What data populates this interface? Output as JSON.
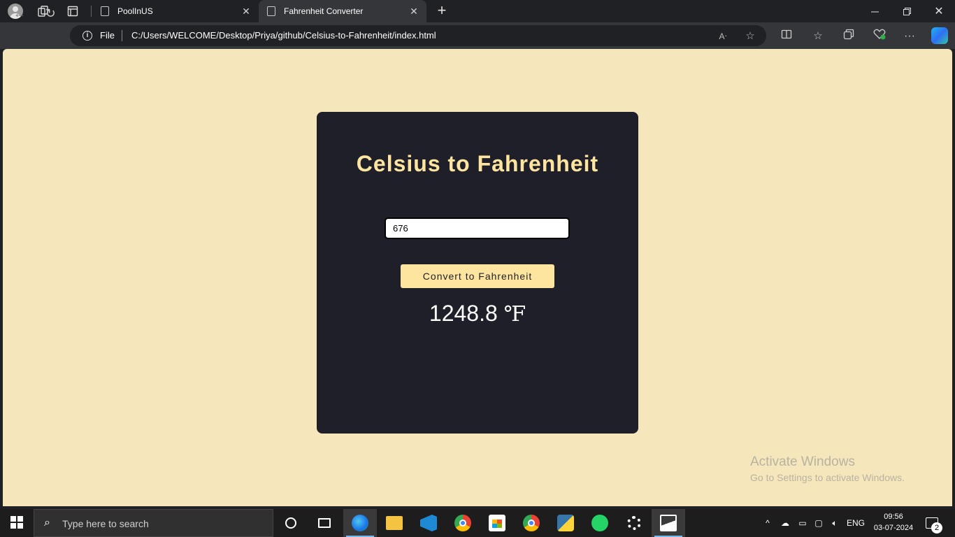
{
  "browser": {
    "tabs": [
      {
        "title": "PoolInUS"
      },
      {
        "title": "Fahrenheit Converter",
        "active": true
      }
    ],
    "address": {
      "scheme_label": "File",
      "url": "C:/Users/WELCOME/Desktop/Priya/github/Celsius-to-Fahrenheit/index.html"
    }
  },
  "page": {
    "title": "Celsius to Fahrenheit",
    "input_value": "676",
    "button_label": "Convert to Fahrenheit",
    "result_value": "1248.8",
    "result_unit": "℉",
    "colors": {
      "background": "#f5e6bc",
      "card": "#1f1f2a",
      "accent": "#fde59f"
    }
  },
  "watermark": {
    "line1": "Activate Windows",
    "line2": "Go to Settings to activate Windows."
  },
  "taskbar": {
    "search_placeholder": "Type here to search",
    "language": "ENG",
    "time": "09:56",
    "date": "03-07-2024",
    "notification_count": "2",
    "apps": [
      "cortana-icon",
      "task-view-icon",
      "edge-icon",
      "file-explorer-icon",
      "vscode-icon",
      "chrome-icon",
      "store-icon",
      "chrome-profile-icon",
      "python-icon",
      "whatsapp-icon",
      "settings-icon",
      "photos-icon"
    ]
  }
}
